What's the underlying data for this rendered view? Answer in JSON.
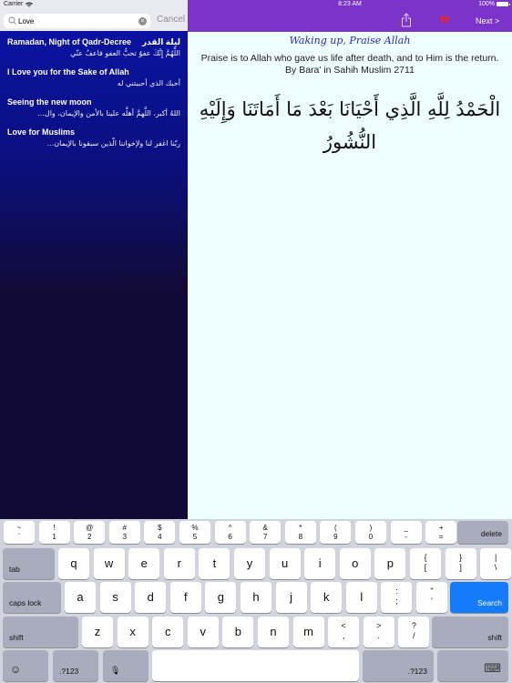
{
  "status_bar": {
    "carrier": "Carrier",
    "time": "8:23 AM",
    "battery": "100%"
  },
  "search": {
    "value": "Love",
    "placeholder": "Search",
    "cancel_label": "Cancel"
  },
  "results": [
    {
      "title": "Ramadan, Night of Qadr-Decree",
      "title_ar": "ليلة القدر",
      "arabic": "اللَّهُمَّ إِنَّكَ عفوٌ تحبُّ العفو فاعفُ عنّي"
    },
    {
      "title": "I Love you for the Sake of Allah",
      "title_ar": "",
      "arabic": "أحبك الذي أحببتني له"
    },
    {
      "title": "Seeing the new moon",
      "title_ar": "",
      "arabic": "اللهُ أكبر، اللَّهمَّ أهلَّه علينا بالأمن والإيمان، وال..."
    },
    {
      "title": "Love for Muslims",
      "title_ar": "",
      "arabic": "ربّنا اغفر لنا ولإخواننا الّذين سبقونا بالإيمان..."
    }
  ],
  "navbar": {
    "share_icon": "share-icon",
    "favorite_icon": "broken-heart-icon",
    "next_label": "Next >"
  },
  "dua": {
    "title": "Waking up, Praise Allah",
    "translation_line1": "Praise is to Allah who gave us life after death, and to Him is the return.",
    "translation_line2": "By Bara' in Sahih Muslim 2711",
    "arabic": "الْحَمْدُ لِلَّهِ الَّذِي أَحْيَانَا بَعْدَ مَا أَمَاتَنَا وَإِلَيْهِ النُّشُورُ"
  },
  "keyboard": {
    "number_row": [
      {
        "top": "~",
        "bottom": "`"
      },
      {
        "top": "!",
        "bottom": "1"
      },
      {
        "top": "@",
        "bottom": "2"
      },
      {
        "top": "#",
        "bottom": "3"
      },
      {
        "top": "$",
        "bottom": "4"
      },
      {
        "top": "%",
        "bottom": "5"
      },
      {
        "top": "^",
        "bottom": "6"
      },
      {
        "top": "&",
        "bottom": "7"
      },
      {
        "top": "*",
        "bottom": "8"
      },
      {
        "top": "(",
        "bottom": "9"
      },
      {
        "top": ")",
        "bottom": "0"
      },
      {
        "top": "_",
        "bottom": "-"
      },
      {
        "top": "+",
        "bottom": "="
      }
    ],
    "delete_label": "delete",
    "tab_label": "tab",
    "row_q": [
      "q",
      "w",
      "e",
      "r",
      "t",
      "y",
      "u",
      "i",
      "o",
      "p"
    ],
    "row_q_extra": [
      {
        "top": "{",
        "bottom": "["
      },
      {
        "top": "}",
        "bottom": "]"
      },
      {
        "top": "|",
        "bottom": "\\"
      }
    ],
    "caps_label": "caps lock",
    "row_a": [
      "a",
      "s",
      "d",
      "f",
      "g",
      "h",
      "j",
      "k",
      "l"
    ],
    "row_a_extra": [
      {
        "top": ":",
        "bottom": ";"
      },
      {
        "top": "\"",
        "bottom": "'"
      }
    ],
    "search_label": "Search",
    "shift_label": "shift",
    "row_z": [
      "z",
      "x",
      "c",
      "v",
      "b",
      "n",
      "m"
    ],
    "row_z_extra": [
      {
        "top": "<",
        "bottom": ","
      },
      {
        "top": ">",
        "bottom": "."
      },
      {
        "top": "?",
        "bottom": "/"
      }
    ],
    "numbers_label": ".?123",
    "emoji_icon": "☺",
    "mic_icon": "🎙",
    "dismiss_icon": "⌨"
  }
}
